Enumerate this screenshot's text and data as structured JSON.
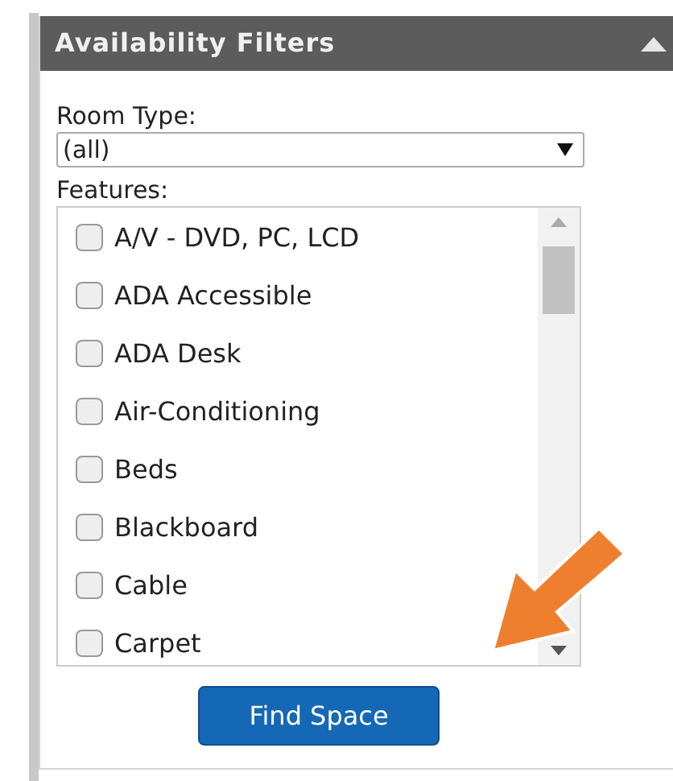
{
  "panel": {
    "title": "Availability Filters",
    "expanded": true
  },
  "room_type": {
    "label": "Room Type:",
    "value": "(all)"
  },
  "features": {
    "label": "Features:",
    "items": [
      {
        "label": "A/V - DVD, PC, LCD",
        "checked": false
      },
      {
        "label": "ADA Accessible",
        "checked": false
      },
      {
        "label": "ADA Desk",
        "checked": false
      },
      {
        "label": "Air-Conditioning",
        "checked": false
      },
      {
        "label": "Beds",
        "checked": false
      },
      {
        "label": "Blackboard",
        "checked": false
      },
      {
        "label": "Cable",
        "checked": false
      },
      {
        "label": "Carpet",
        "checked": false
      }
    ]
  },
  "button": "Find Space"
}
